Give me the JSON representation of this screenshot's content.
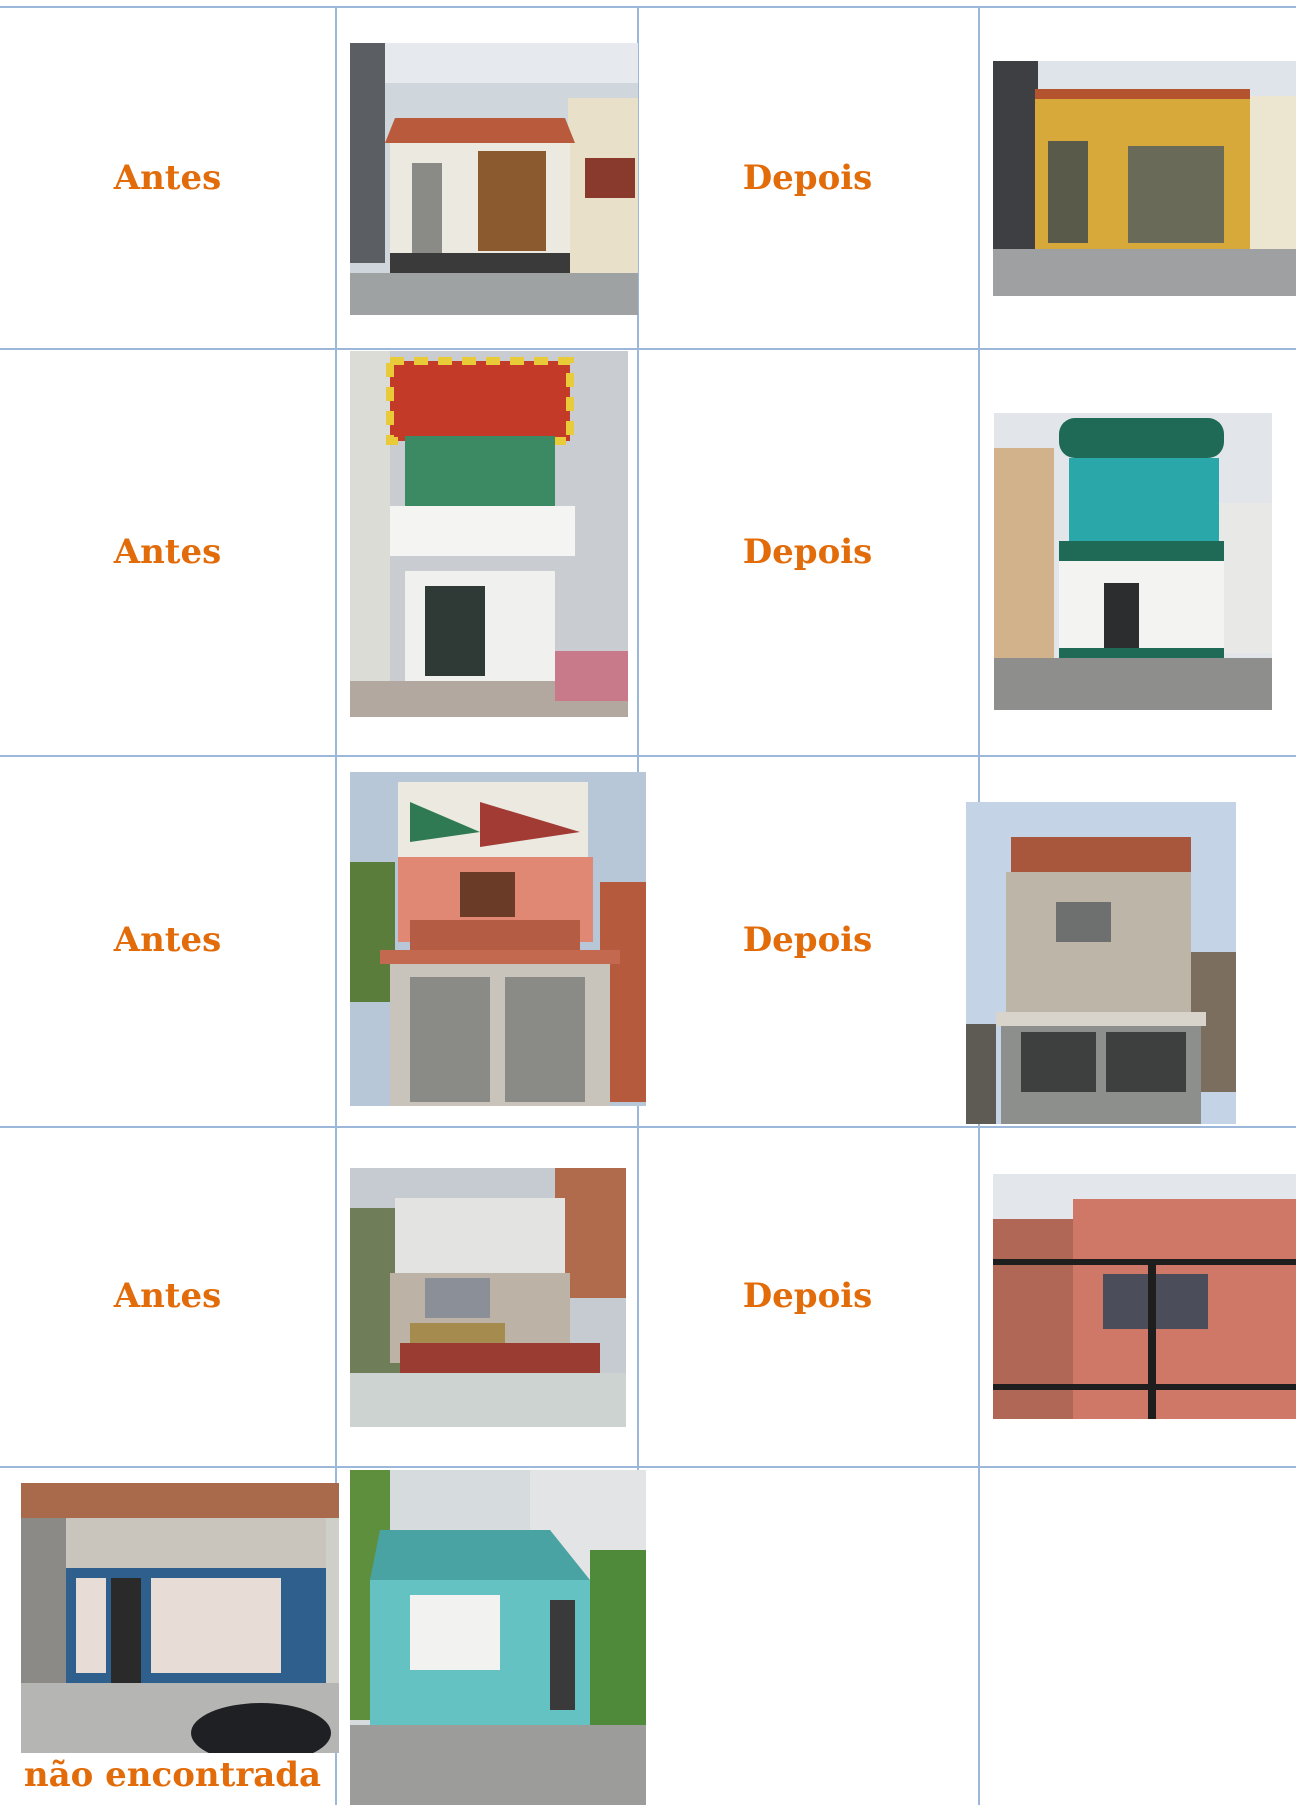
{
  "colors": {
    "label": "#e36c0a",
    "grid": "#9bb7d9"
  },
  "rows": [
    {
      "before_label": "Antes",
      "after_label": "Depois"
    },
    {
      "before_label": "Antes",
      "after_label": "Depois"
    },
    {
      "before_label": "Antes",
      "after_label": "Depois"
    },
    {
      "before_label": "Antes",
      "after_label": "Depois"
    }
  ],
  "last_row": {
    "caption": "não encontrada"
  }
}
